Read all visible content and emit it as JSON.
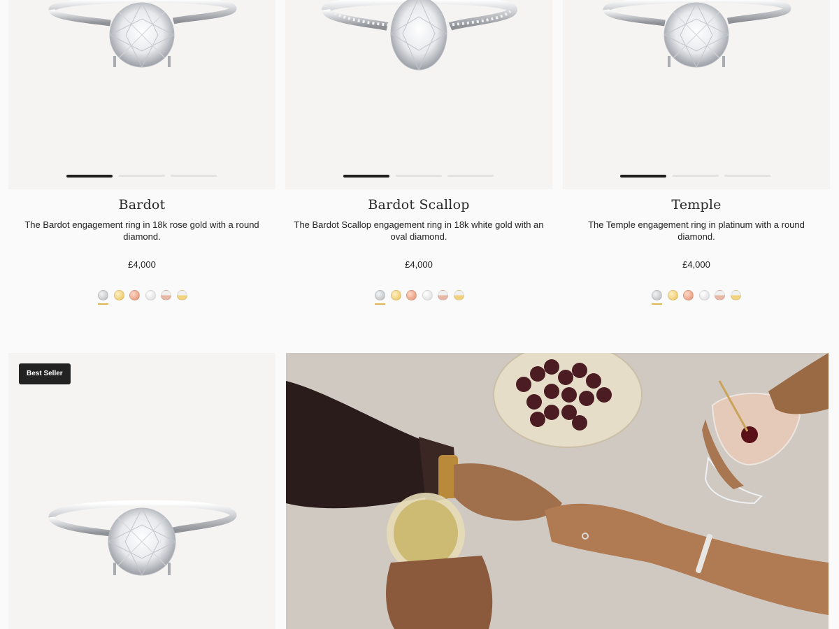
{
  "products": [
    {
      "name": "Bardot",
      "description": "The Bardot engagement ring in 18k rose gold with a round diamond.",
      "price": "£4,000",
      "image": "round-solitaire-ring",
      "gallery_slides": 3,
      "active_slide": 1
    },
    {
      "name": "Bardot Scallop",
      "description": "The Bardot Scallop engagement ring in 18k white gold with an oval diamond.",
      "price": "£4,000",
      "image": "oval-pave-ring",
      "gallery_slides": 3,
      "active_slide": 1
    },
    {
      "name": "Temple",
      "description": "The Temple engagement ring in platinum with a round diamond.",
      "price": "£4,000",
      "image": "round-solitaire-ring",
      "gallery_slides": 3,
      "active_slide": 1
    }
  ],
  "metal_swatches": [
    {
      "metal": "platinum",
      "color": "#c4c6c9",
      "selected": true
    },
    {
      "metal": "yellow-gold",
      "color": "#f1cf78",
      "selected": false
    },
    {
      "metal": "rose-gold",
      "color": "#e8a184",
      "selected": false
    },
    {
      "metal": "white-gold",
      "color": "#e6e6e6",
      "selected": false
    },
    {
      "metal": "white-rose",
      "color": "#ead7d2",
      "selected": false
    },
    {
      "metal": "white-yellow",
      "color": "#efe3c4",
      "selected": false
    }
  ],
  "bottom_card": {
    "badge": "Best Seller",
    "image": "round-solitaire-ring"
  },
  "lifestyle_image": "couple-holding-hands-drinks",
  "colors": {
    "image_bg": "#f5f4f2",
    "swatch_underline": "#e0b45a",
    "badge_bg": "#222222"
  }
}
